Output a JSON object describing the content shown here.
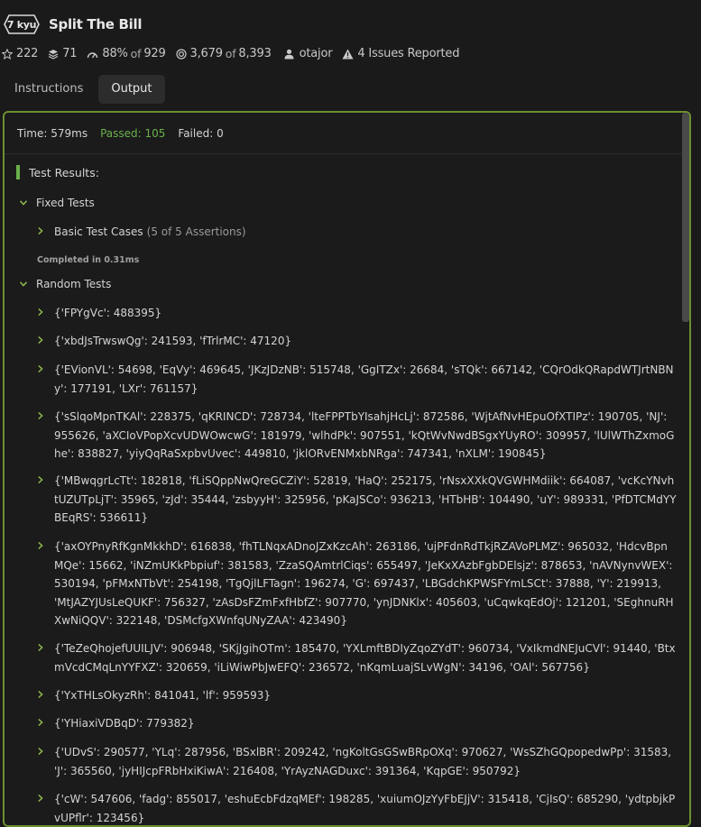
{
  "kata": {
    "rank": "7 kyu",
    "title": "Split The Bill"
  },
  "stats": {
    "stars": "222",
    "collections": "71",
    "satisfaction": "88%",
    "satisfaction_of": "of",
    "satisfaction_total": "929",
    "completions": "3,679",
    "completions_of": "of",
    "completions_total": "8,393",
    "author": "otajor",
    "issues": "4 Issues Reported"
  },
  "tabs": [
    {
      "label": "Instructions"
    },
    {
      "label": "Output"
    }
  ],
  "summary": {
    "time": "Time: 579ms",
    "passed": "Passed: 105",
    "failed": "Failed: 0"
  },
  "results": {
    "title": "Test Results:",
    "fixed_label": "Fixed Tests",
    "basic_label": "Basic Test Cases",
    "basic_assertions": "(5 of 5 Assertions)",
    "completed": "Completed in 0.31ms",
    "random_label": "Random Tests",
    "random_items": [
      "{'FPYgVc': 488395}",
      "{'xbdJsTrwswQg': 241593, 'fTrlrMC': 47120}",
      "{'EVionVL': 54698, 'EqVy': 469645, 'JKzJDzNB': 515748, 'GgITZx': 26684, 'sTQk': 667142, 'CQrOdkQRapdWTJrtNBNy': 177191, 'LXr': 761157}",
      "{'sSlqoMpnTKAl': 228375, 'qKRINCD': 728734, 'lteFPPTbYIsahjHcLj': 872586, 'WjtAfNvHEpuOfXTIPz': 190705, 'NJ': 955626, 'aXCIoVPopXcvUDWOwcwG': 181979, 'wlhdPk': 907551, 'kQtWvNwdBSgxYUyRO': 309957, 'lUlWThZxmoGhe': 838827, 'yiyQqRaSxpbvUvec': 449810, 'jklORvENMxbNRga': 747341, 'nXLM': 190845}",
      "{'MBwqgrLcTt': 182818, 'fLiSQppNwQreGCZiY': 52819, 'HaQ': 252175, 'rNsxXXkQVGWHMdiik': 664087, 'vcKcYNvhtUZUTpLjT': 35965, 'zJd': 35444, 'zsbyyH': 325956, 'pKaJSCo': 936213, 'HTbHB': 104490, 'uY': 989331, 'PfDTCMdYYBEqRS': 536611}",
      "{'axOYPnyRfKgnMkkhD': 616838, 'fhTLNqxADnoJZxKzcAh': 263186, 'ujPFdnRdTkjRZAVoPLMZ': 965032, 'HdcvBpnMQe': 15662, 'iNZmUKkPbpiuf': 381583, 'ZzaSQAmtrlCiqs': 655497, 'JeKxXAzbFgbDElsjz': 878653, 'nAVNynvWEX': 530194, 'pFMxNTbVt': 254198, 'TgQjlLFTagn': 196274, 'G': 697437, 'LBGdchKPWSFYmLSCt': 37888, 'Y': 219913, 'MtJAZYJUsLeQUKF': 756327, 'zAsDsFZmFxfHbfZ': 907770, 'ynJDNKlx': 405603, 'uCqwkqEdOj': 121201, 'SEghnuRHXwNiQQV': 322148, 'DSMcfgXWnfqUNyZAA': 423490}",
      "{'TeZeQhojefUUILJV': 906948, 'SKjJgihOTm': 185470, 'YXLmftBDIyZqoZYdT': 960734, 'VxIkmdNEJuCVl': 91440, 'BtxmVcdCMqLnYYFXZ': 320659, 'iLiWiwPbJwEFQ': 236572, 'nKqmLuajSLvWgN': 34196, 'OAl': 567756}",
      "{'YxTHLsOkyzRh': 841041, 'lf': 959593}",
      "{'YHiaxiVDBqD': 779382}",
      "{'UDvS': 290577, 'YLq': 287956, 'BSxlBR': 209242, 'ngKoltGsGSwBRpOXq': 970627, 'WsSZhGQpopedwPp': 31583, 'J': 365560, 'jyHIJcpFRbHxiKiwA': 216408, 'YrAyzNAGDuxc': 391364, 'KqpGE': 950792}",
      "{'cW': 547606, 'fadg': 855017, 'eshuEcbFdzqMEf': 198285, 'xuiumOJzYyFbEJjV': 315418, 'CjIsQ': 685290, 'ydtpbjkPvUPflr': 123456}"
    ]
  }
}
